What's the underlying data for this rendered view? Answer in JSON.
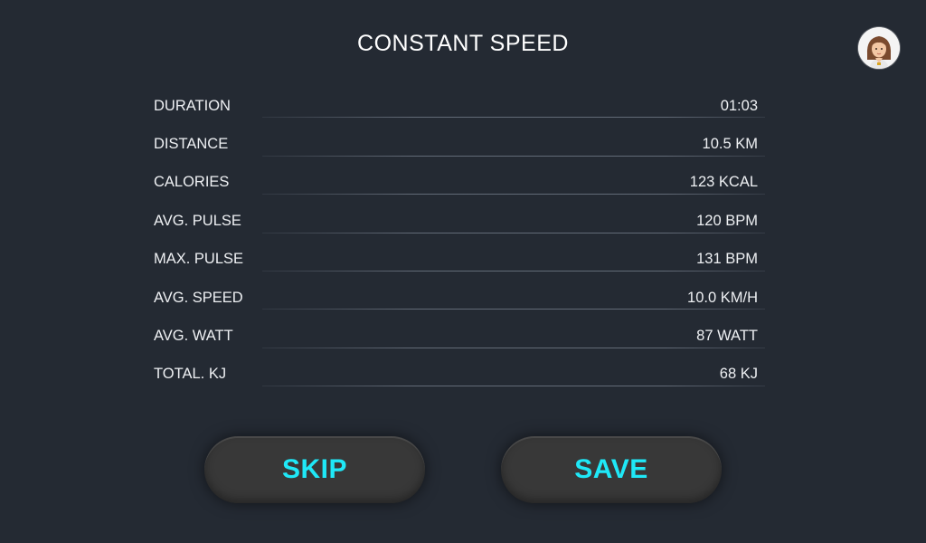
{
  "header": {
    "title": "CONSTANT SPEED"
  },
  "user": {
    "avatar_icon": "user-avatar-icon"
  },
  "stats": [
    {
      "label": "DURATION",
      "value": "01:03"
    },
    {
      "label": "DISTANCE",
      "value": "10.5 KM"
    },
    {
      "label": "CALORIES",
      "value": "123 KCAL"
    },
    {
      "label": "AVG. PULSE",
      "value": "120 BPM"
    },
    {
      "label": "MAX. PULSE",
      "value": "131 BPM"
    },
    {
      "label": "AVG. SPEED",
      "value": "10.0 KM/H"
    },
    {
      "label": "AVG. WATT",
      "value": "87 WATT"
    },
    {
      "label": "TOTAL. KJ",
      "value": "68 KJ"
    }
  ],
  "actions": {
    "skip_label": "SKIP",
    "save_label": "SAVE"
  },
  "colors": {
    "background": "#242a33",
    "button_bg": "#383838",
    "accent": "#1fe8f7"
  }
}
